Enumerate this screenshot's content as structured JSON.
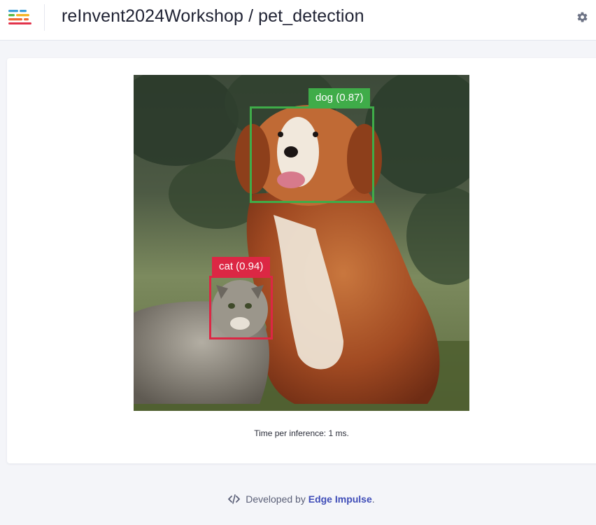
{
  "header": {
    "title": "reInvent2024Workshop / pet_detection",
    "logo_icon": "edge-impulse-logo-icon",
    "settings_icon": "gear-icon"
  },
  "detections": [
    {
      "label": "dog (0.87)",
      "color": "#3fac49"
    },
    {
      "label": "cat (0.94)",
      "color": "#dc2744"
    }
  ],
  "inference_text": "Time per inference: 1 ms.",
  "footer": {
    "prefix": "Developed by",
    "link": "Edge Impulse",
    "suffix": ".",
    "icon": "code-icon"
  },
  "colors": {
    "dog_box": "#3fac49",
    "cat_box": "#dc2744",
    "link": "#3f4db8"
  }
}
